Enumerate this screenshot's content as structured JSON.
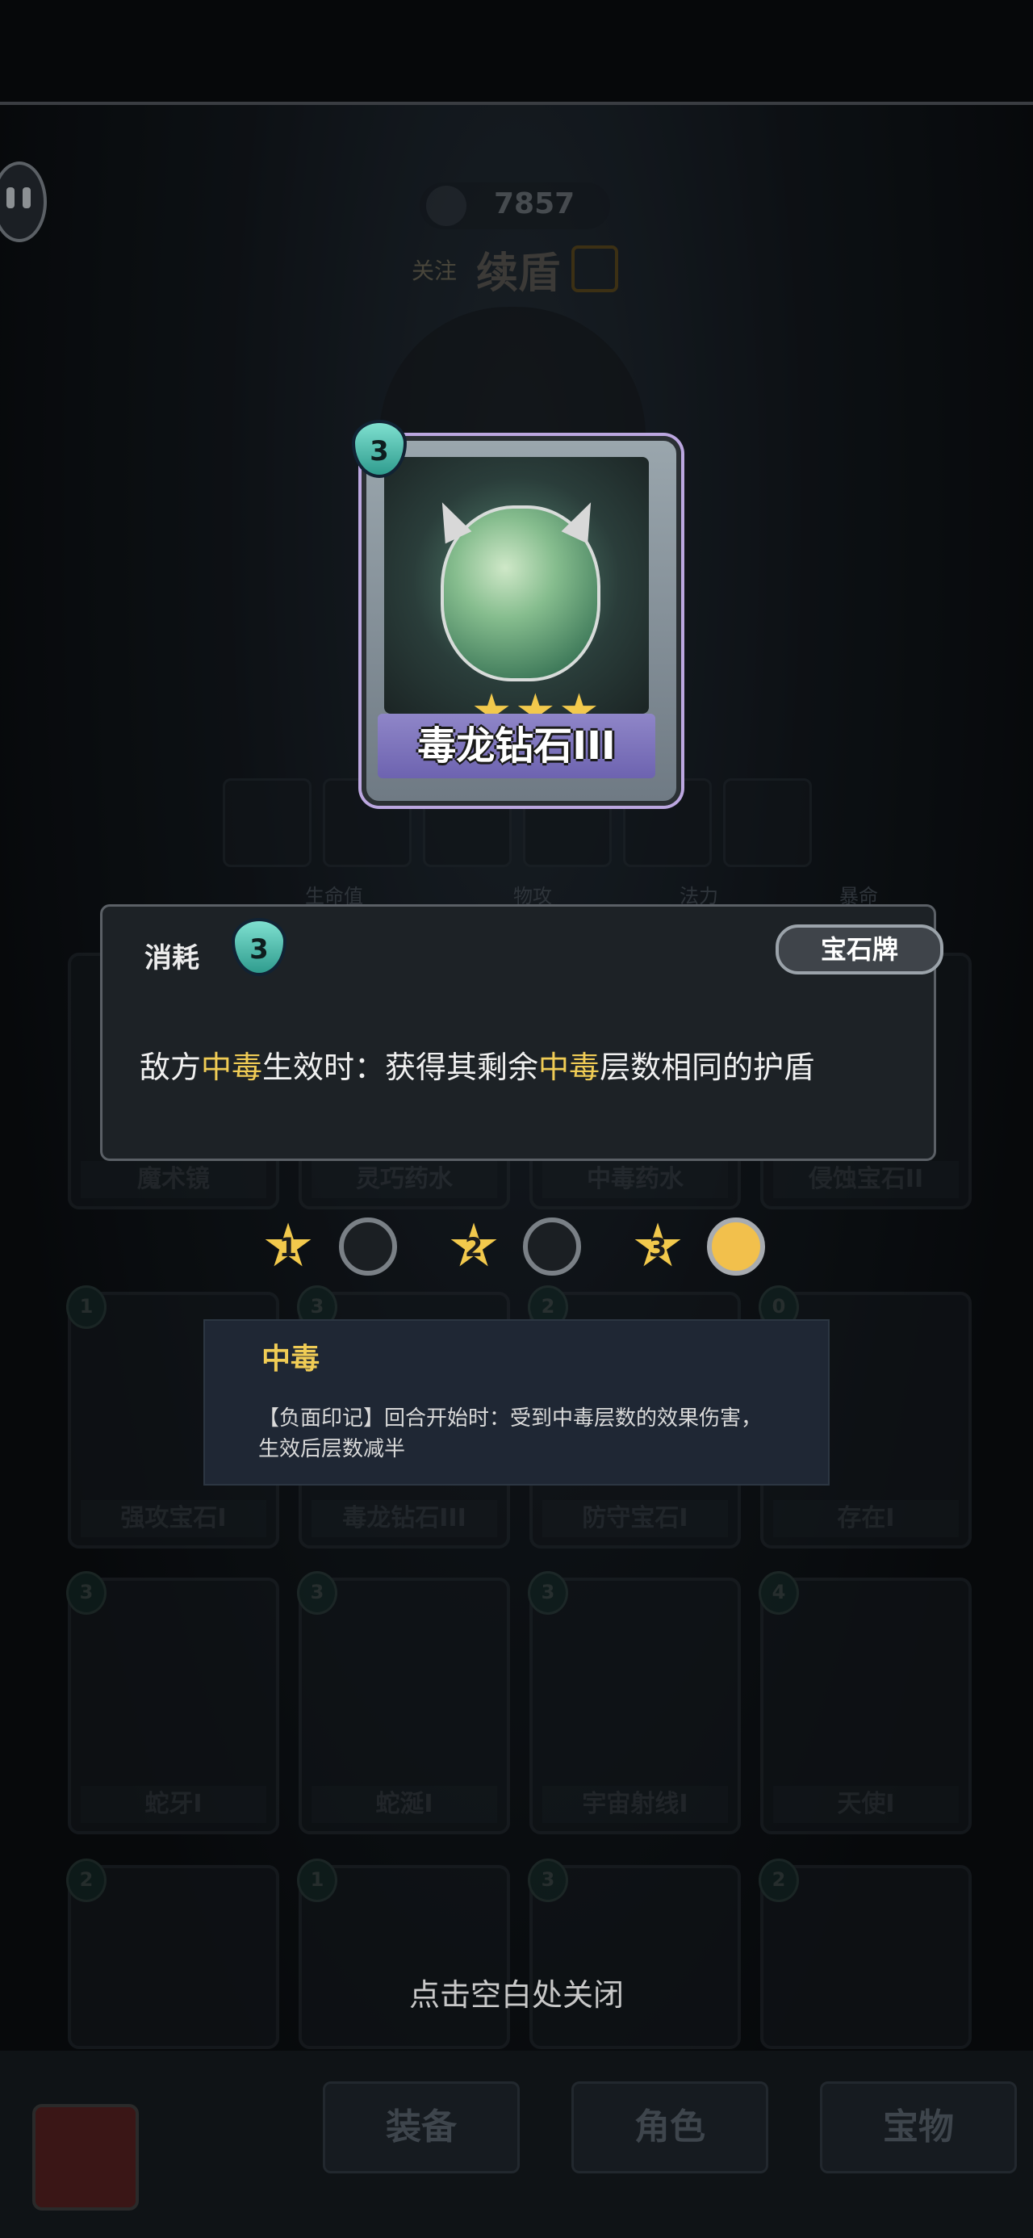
{
  "header": {
    "currency_value": "7857",
    "follow_label": "关注",
    "hero_name": "续盾"
  },
  "card": {
    "name": "毒龙钻石III",
    "cost": "3",
    "stars": "★★★"
  },
  "stats_bar": [
    "生命值",
    "物攻",
    "法力",
    "暴命"
  ],
  "description": {
    "consume_label": "消耗",
    "cost": "3",
    "type_badge": "宝石牌",
    "parts": [
      "敌方",
      "中毒",
      "生效时：获得其剩余",
      "中毒",
      "层数相同的护盾"
    ]
  },
  "upgrade_levels": {
    "numbers": [
      "1",
      "2",
      "3"
    ],
    "active_index": 2
  },
  "grid_row1_labels": [
    "魔术镜",
    "灵巧药水",
    "中毒药水",
    "侵蚀宝石II"
  ],
  "grid_cards": [
    {
      "label": "强攻宝石I",
      "cost": "1"
    },
    {
      "label": "毒龙钻石III",
      "cost": "3"
    },
    {
      "label": "防守宝石I",
      "cost": "2"
    },
    {
      "label": "存在I",
      "cost": "0"
    },
    {
      "label": "蛇牙I",
      "cost": "3"
    },
    {
      "label": "蛇涎I",
      "cost": "3"
    },
    {
      "label": "宇宙射线I",
      "cost": "3"
    },
    {
      "label": "天使I",
      "cost": "4"
    },
    {
      "label": "",
      "cost": "2"
    },
    {
      "label": "",
      "cost": "1"
    },
    {
      "label": "",
      "cost": "3"
    },
    {
      "label": "",
      "cost": "2"
    }
  ],
  "tooltip": {
    "title": "中毒",
    "line1": "【负面印记】回合开始时：受到中毒层数的效果伤害，",
    "line2": "生效后层数减半"
  },
  "close_hint": "点击空白处关闭",
  "tabs": [
    "装备",
    "角色",
    "宝物"
  ],
  "colors": {
    "highlight": "#f0cc55",
    "star": "#f2c94c",
    "card_name_band": "#7a70bb"
  }
}
